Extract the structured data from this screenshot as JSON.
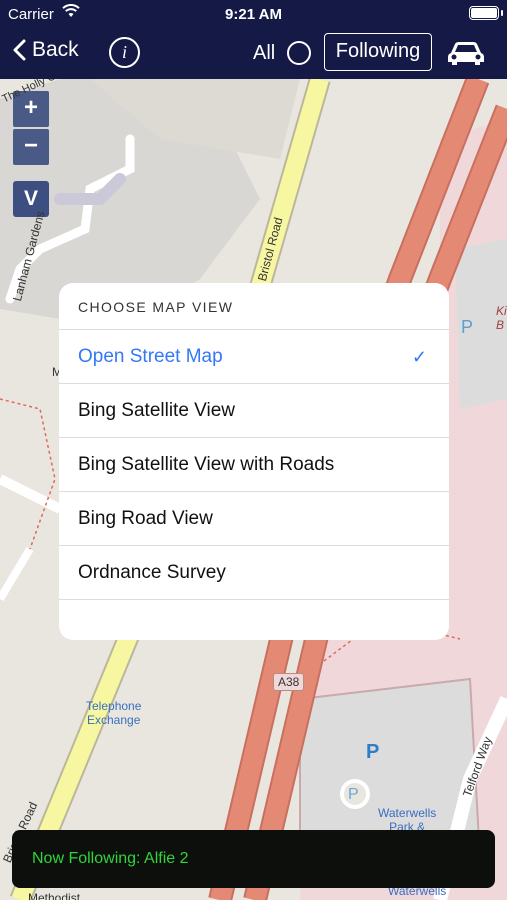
{
  "status": {
    "carrier": "Carrier",
    "time": "9:21 AM"
  },
  "nav": {
    "back_label": "Back",
    "info_label": "i",
    "all_label": "All",
    "following_label": "Following"
  },
  "map": {
    "zoom_in": "+",
    "zoom_out": "−",
    "view_button": "V",
    "labels": {
      "holly": "The Holly Gr",
      "lanham": "Lanham Gardens",
      "bristol": "Bristol Road",
      "a38": "A38",
      "telephone": "Telephone\nExchange",
      "telford": "Telford Way",
      "waterwells_park": "Waterwells\nPark &",
      "waterwells": "Waterwells",
      "methodist": "Methodist",
      "kb": "Ki\nB",
      "bristol_road2": "Bristol Road",
      "m": "M",
      "p_small": "P",
      "p_large": "P",
      "p_circle": "P"
    }
  },
  "dialog": {
    "title": "CHOOSE MAP VIEW",
    "options": [
      "Open Street Map",
      "Bing Satellite View",
      "Bing Satellite View with Roads",
      "Bing Road View",
      "Ordnance Survey"
    ],
    "selected_index": 0,
    "check_mark": "✓"
  },
  "toast": {
    "text": "Now Following: Alfie 2"
  },
  "colors": {
    "nav_bg": "#141a45",
    "accent_blue": "#3478f6",
    "toast_text": "#2fd53a",
    "road_red": "#e48a74",
    "road_yellow": "#f6f7a0"
  }
}
